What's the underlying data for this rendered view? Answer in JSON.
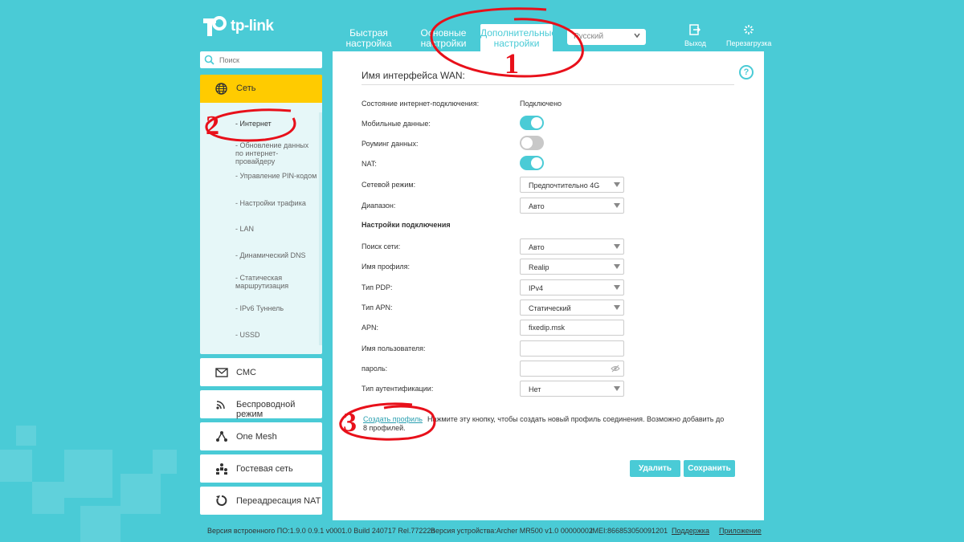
{
  "brand": {
    "name": "tp-link"
  },
  "tabs": [
    {
      "label": "Быстрая настройка"
    },
    {
      "label": "Основные настройки"
    },
    {
      "label": "Дополнительные настройки"
    }
  ],
  "language": {
    "value": "Русский"
  },
  "header_buttons": {
    "logout": "Выход",
    "reboot": "Перезагрузка"
  },
  "search": {
    "placeholder": "Поиск"
  },
  "sidebar": {
    "active_section": {
      "label": "Сеть",
      "icon": "globe-icon"
    },
    "sub_items": [
      {
        "label": "- Интернет"
      },
      {
        "label": "- Обновление данных по интернет-провайдеру"
      },
      {
        "label": "- Управление PIN-кодом"
      },
      {
        "label": "- Настройки трафика"
      },
      {
        "label": "- LAN"
      },
      {
        "label": "- Динамический DNS"
      },
      {
        "label": "- Статическая маршрутизация"
      },
      {
        "label": "- IPv6 Туннель"
      },
      {
        "label": "- USSD"
      }
    ],
    "sections": [
      {
        "label": "СМС",
        "icon": "envelope-icon"
      },
      {
        "label": "Беспроводной режим",
        "icon": "wifi-icon"
      },
      {
        "label": "One Mesh",
        "icon": "mesh-icon"
      },
      {
        "label": "Гостевая сеть",
        "icon": "guest-icon"
      },
      {
        "label": "Переадресация NAT",
        "icon": "nat-icon"
      }
    ]
  },
  "main": {
    "title": "Имя интерфейса WAN:",
    "rows": {
      "status": {
        "label": "Состояние интернет-подключения:",
        "value": "Подключено"
      },
      "mobile_data": {
        "label": "Мобильные данные:",
        "on": true
      },
      "roaming": {
        "label": "Роуминг данных:",
        "on": false
      },
      "nat": {
        "label": "NAT:",
        "on": true
      },
      "network_mode": {
        "label": "Сетевой режим:",
        "value": "Предпочтительно 4G"
      },
      "band": {
        "label": "Диапазон:",
        "value": "Авто"
      }
    },
    "connection_header": "Настройки подключения",
    "conn": {
      "network_search": {
        "label": "Поиск сети:",
        "value": "Авто"
      },
      "profile_name": {
        "label": "Имя профиля:",
        "value": "Realip"
      },
      "pdp_type": {
        "label": "Тип PDP:",
        "value": "IPv4"
      },
      "apn_type": {
        "label": "Тип APN:",
        "value": "Статический"
      },
      "apn": {
        "label": "APN:",
        "value": "fixedip.msk"
      },
      "username": {
        "label": "Имя пользователя:",
        "value": ""
      },
      "password": {
        "label": "пароль:",
        "value": ""
      },
      "auth_type": {
        "label": "Тип аутентификации:",
        "value": "Нет"
      }
    },
    "create_profile_link": "Создать профиль",
    "create_profile_note": "Нажмите эту кнопку, чтобы создать новый профиль соединения. Возможно добавить до 8 профилей.",
    "delete_button": "Удалить",
    "save_button": "Сохранить"
  },
  "footer": {
    "firmware": "Версия встроенного ПО:1.9.0 0.9.1 v0001.0 Build 240717 Rel.77222n",
    "hardware": "Версия устройства:Archer MR500 v1.0 00000002",
    "imei": "IMEI:866853050091201",
    "support": "Поддержка",
    "app": "Приложение"
  },
  "annotations": [
    "1",
    "2",
    "3"
  ],
  "colors": {
    "accent": "#4acbd6",
    "active_nav": "#ffcb00",
    "annotation": "#e8101a"
  }
}
